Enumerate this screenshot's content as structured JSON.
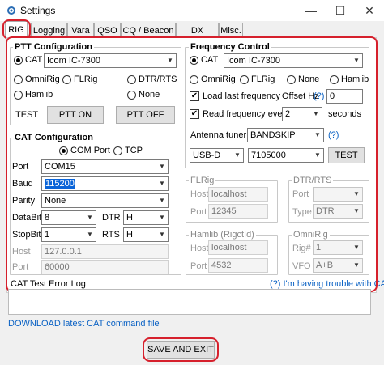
{
  "window": {
    "title": "Settings",
    "minimize_glyph": "—",
    "maximize_glyph": "☐",
    "close_glyph": "✕"
  },
  "tabs": [
    "RIG",
    "Logging",
    "Vara",
    "QSO",
    "CQ / Beacon",
    "DX Cluster",
    "Misc."
  ],
  "ptt": {
    "title": "PTT Configuration",
    "cat_label": "CAT",
    "rig_value": "Icom IC-7300",
    "omnirig": "OmniRig",
    "flrig": "FLRig",
    "dtr_rts": "DTR/RTS",
    "hamlib": "Hamlib",
    "none": "None",
    "test_label": "TEST",
    "ptt_on": "PTT ON",
    "ptt_off": "PTT OFF"
  },
  "cat": {
    "title": "CAT Configuration",
    "com_port": "COM Port",
    "tcp": "TCP",
    "port_label": "Port",
    "port_value": "COM15",
    "baud_label": "Baud",
    "baud_value": "115200",
    "parity_label": "Parity",
    "parity_value": "None",
    "databits_label": "DataBits",
    "databits_value": "8",
    "dtr_label": "DTR",
    "dtr_value": "H",
    "stopbits_label": "StopBits",
    "stopbits_value": "1",
    "rts_label": "RTS",
    "rts_value": "H",
    "host_label": "Host",
    "host_value": "127.0.0.1",
    "tcpport_label": "Port",
    "tcpport_value": "60000"
  },
  "freq": {
    "title": "Frequency Control",
    "cat_label": "CAT",
    "rig_value": "Icom IC-7300",
    "omnirig": "OmniRig",
    "flrig": "FLRig",
    "none": "None",
    "hamlib": "Hamlib",
    "load_last": "Load last frequency",
    "offset_label": "Offset Hz",
    "offset_help": "(?)",
    "offset_value": "0",
    "read_every": "Read frequency every",
    "read_value": "2",
    "seconds": "seconds",
    "tuner_label": "Antenna tuner",
    "tuner_value": "BANDSKIP",
    "tuner_help": "(?)",
    "mode_value": "USB-D",
    "freq_value": "7105000",
    "test_button": "TEST"
  },
  "flrig": {
    "title": "FLRig",
    "host_label": "Host",
    "host_value": "localhost",
    "port_label": "Port",
    "port_value": "12345"
  },
  "dtrrts": {
    "title": "DTR/RTS",
    "port_label": "Port",
    "port_value": "",
    "type_label": "Type",
    "type_value": "DTR"
  },
  "hamlib": {
    "title": "Hamlib (RigctId)",
    "host_label": "Host",
    "host_value": "localhost",
    "port_label": "Port",
    "port_value": "4532"
  },
  "omnirig": {
    "title": "OmniRig",
    "rig_label": "Rig#",
    "rig_value": "1",
    "vfo_label": "VFO",
    "vfo_value": "A+B"
  },
  "footer": {
    "error_log": "CAT Test Error Log",
    "trouble_link": "(?) I'm having trouble with CAT",
    "download_link": "DOWNLOAD latest CAT command file",
    "save_button": "SAVE AND EXIT"
  },
  "colors": {
    "highlight_red": "#d6202c",
    "link_blue": "#0b62c4",
    "selection_blue": "#0a64d8"
  }
}
